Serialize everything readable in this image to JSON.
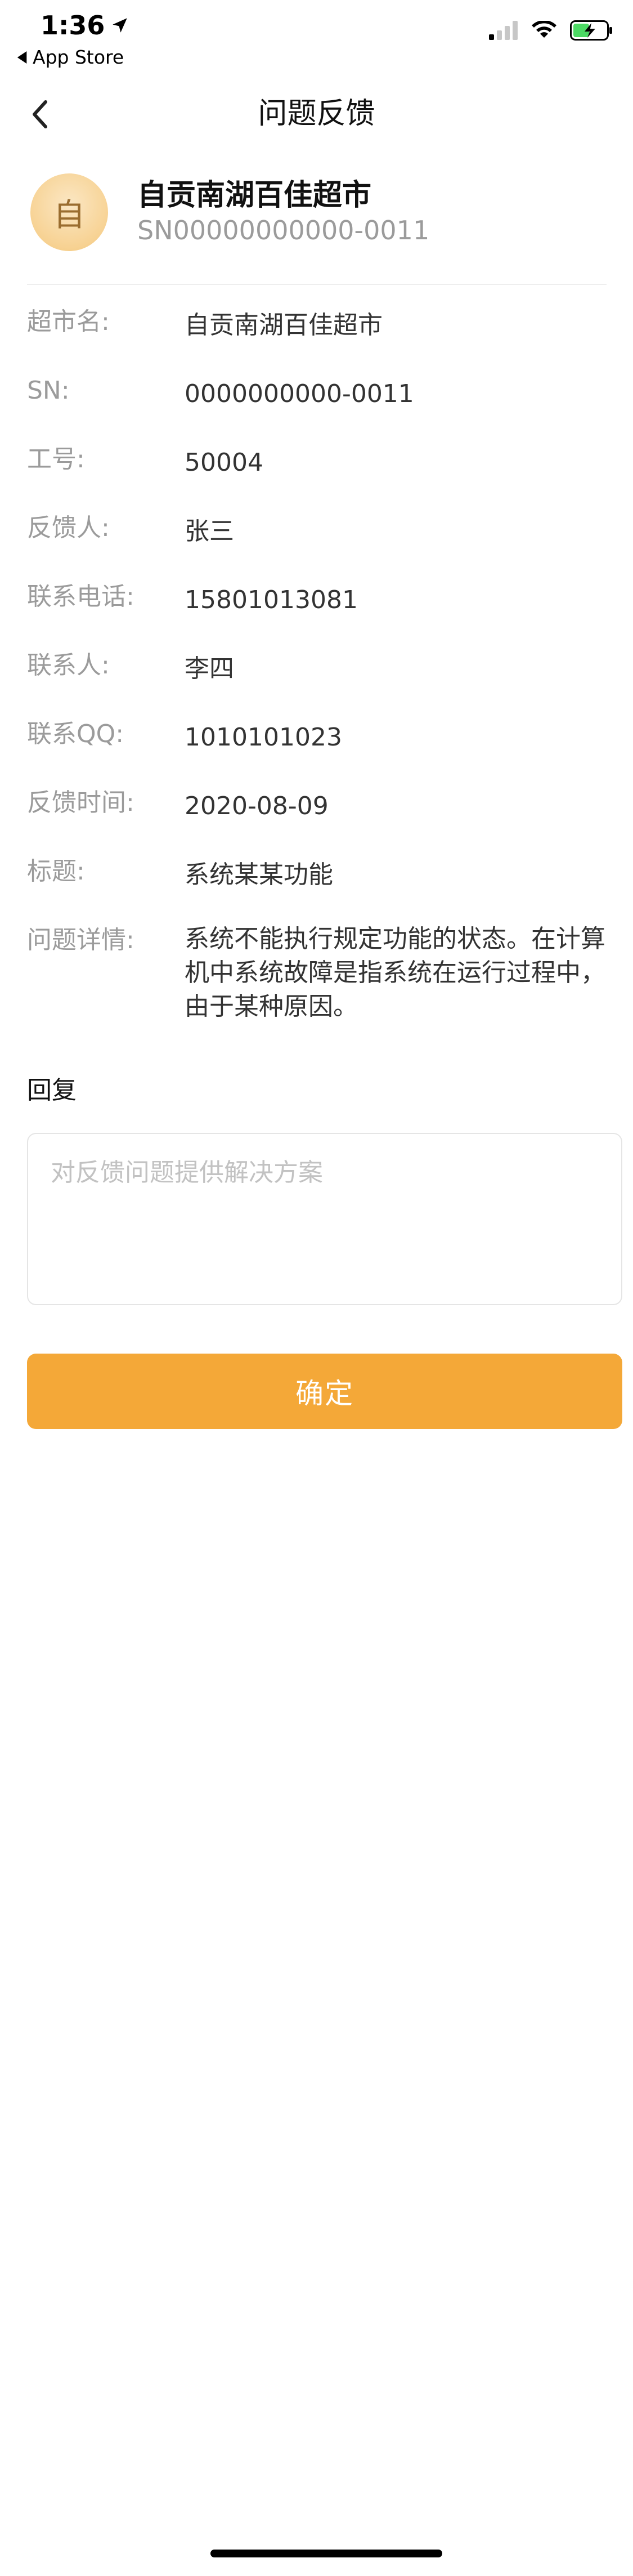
{
  "status_bar": {
    "time": "1:36",
    "back_app": "App Store"
  },
  "nav": {
    "title": "问题反馈"
  },
  "store": {
    "avatar_char": "自",
    "name": "自贡南湖百佳超市",
    "sn": "SN00000000000-0011"
  },
  "info": [
    {
      "label": "超市名:",
      "value": "自贡南湖百佳超市"
    },
    {
      "label": "SN:",
      "value": "0000000000-0011"
    },
    {
      "label": "工号:",
      "value": "50004"
    },
    {
      "label": "反馈人:",
      "value": "张三"
    },
    {
      "label": "联系电话:",
      "value": "15801013081"
    },
    {
      "label": "联系人:",
      "value": "李四"
    },
    {
      "label": "联系QQ:",
      "value": "1010101023"
    },
    {
      "label": "反馈时间:",
      "value": "2020-08-09"
    },
    {
      "label": "标题:",
      "value": "系统某某功能"
    },
    {
      "label": "问题详情:",
      "value": "系统不能执行规定功能的状态。在计算机中系统故障是指系统在运行过程中，由于某种原因。"
    }
  ],
  "reply": {
    "title": "回复",
    "placeholder": "对反馈问题提供解决方案",
    "value": ""
  },
  "confirm_label": "确定",
  "colors": {
    "accent": "#f4a838",
    "label_gray": "#9b9b9b",
    "avatar_bg": "#f7d293"
  }
}
